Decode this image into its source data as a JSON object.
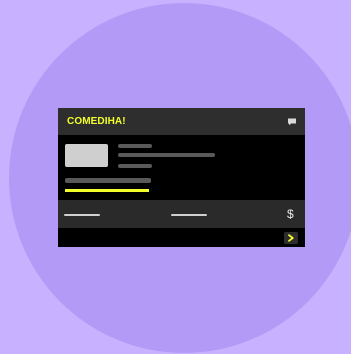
{
  "app": {
    "brand": "COMEDIHA!"
  },
  "header": {
    "chat_icon": "chat-icon"
  },
  "content": {
    "thumbnail_icon": "image-placeholder",
    "progress_value": 0.79
  },
  "toolbar": {
    "currency_symbol": "$"
  },
  "footer": {
    "next_icon": "chevron-right-icon"
  },
  "colors": {
    "background": "#c8b1ff",
    "circle": "#b39af6",
    "card": "#000000",
    "header": "#2e2e2e",
    "accent": "#f3ff2a",
    "placeholder": "#595959",
    "thumbnail": "#cfcfcf",
    "toolbar": "#2a2a2a"
  }
}
